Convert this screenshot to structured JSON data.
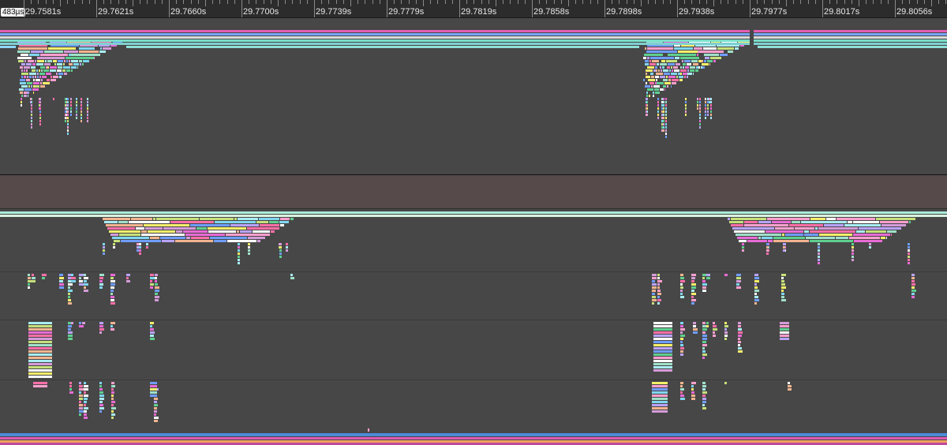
{
  "timeline": {
    "scale_label": "483µs",
    "tick_labels": [
      "29.7581s",
      "29.7621s",
      "29.7660s",
      "29.7700s",
      "29.7739s",
      "29.7779s",
      "29.7819s",
      "29.7858s",
      "29.7898s",
      "29.7938s",
      "29.7977s",
      "29.8017s",
      "29.8056s"
    ]
  },
  "palette": [
    "#f5ee6b",
    "#ff9fcf",
    "#e86bd6",
    "#9fe0c9",
    "#b9a3ff",
    "#7fd6f0",
    "#c6e07a",
    "#f2b48f",
    "#ffffff",
    "#6f9dff",
    "#5fcf8f",
    "#ff6fa8",
    "#d59bd9",
    "#a8ecf2"
  ],
  "tracks": {
    "top_bars": [
      "#e45fb3",
      "#78a7ff",
      "#d9d9d9",
      "#79dfc9",
      "#7fd0d0"
    ],
    "bottom_bars": [
      "#4d8ad8",
      "#e05ab0",
      "#f0a060"
    ]
  }
}
